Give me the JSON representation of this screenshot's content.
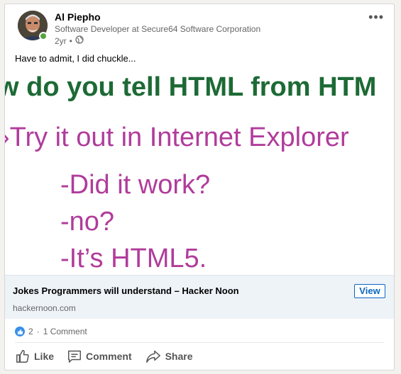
{
  "post": {
    "author": "Al Piepho",
    "headline": "Software Developer at Secure64 Software Corporation",
    "time": "2yr",
    "separator": "•",
    "commentary": "Have to admit, I did chuckle..."
  },
  "meme": {
    "line1": "w do you tell HTML from HTM",
    "line2": "›Try it out in Internet Explorer",
    "line3": "-Did it work?",
    "line4": "-no?",
    "line5": "-It’s HTML5."
  },
  "link": {
    "title": "Jokes Programmers will understand – Hacker Noon",
    "source": "hackernoon.com",
    "view_label": "View"
  },
  "social": {
    "reactions": "2",
    "separator": "·",
    "comments": "1 Comment"
  },
  "actions": {
    "like": "Like",
    "comment": "Comment",
    "share": "Share"
  },
  "colors": {
    "brand": "#0a66c2",
    "presence": "#57a341",
    "meme_green": "#1d6a35",
    "meme_magenta": "#b03c9b"
  },
  "icons": [
    "more-options-icon",
    "globe-icon",
    "like-reaction-icon",
    "like-icon",
    "comment-icon",
    "share-icon"
  ]
}
